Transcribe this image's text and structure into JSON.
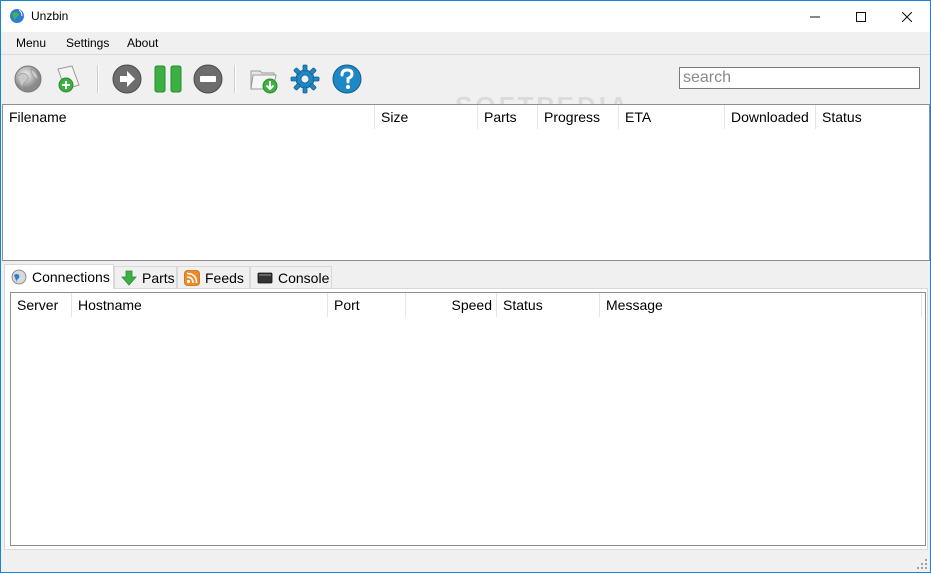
{
  "window": {
    "title": "Unzbin"
  },
  "window_controls": {
    "minimize": "—",
    "maximize": "☐",
    "close": "✕"
  },
  "menu": {
    "items": [
      "Menu",
      "Settings",
      "About"
    ]
  },
  "toolbar": {
    "buttons": [
      "globe-icon",
      "add-file-icon",
      "start-icon",
      "pause-icon",
      "stop-icon",
      "open-folder-icon",
      "settings-gear-icon",
      "help-icon"
    ]
  },
  "search": {
    "placeholder": "search",
    "value": ""
  },
  "downloads_table": {
    "columns": [
      "Filename",
      "Size",
      "Parts",
      "Progress",
      "ETA",
      "Downloaded",
      "Status"
    ],
    "rows": []
  },
  "watermark": "SOFTPEDIA",
  "tabs": [
    {
      "label": "Connections",
      "icon": "globe-icon",
      "active": true
    },
    {
      "label": "Parts",
      "icon": "download-arrow-icon",
      "active": false
    },
    {
      "label": "Feeds",
      "icon": "rss-icon",
      "active": false
    },
    {
      "label": "Console",
      "icon": "console-icon",
      "active": false
    }
  ],
  "connections_table": {
    "columns": [
      "Server",
      "Hostname",
      "Port",
      "Speed",
      "Status",
      "Message"
    ],
    "rows": []
  },
  "colors": {
    "window_border": "#1883d7",
    "accent_green": "#3cb043",
    "accent_blue": "#1e88c7"
  }
}
